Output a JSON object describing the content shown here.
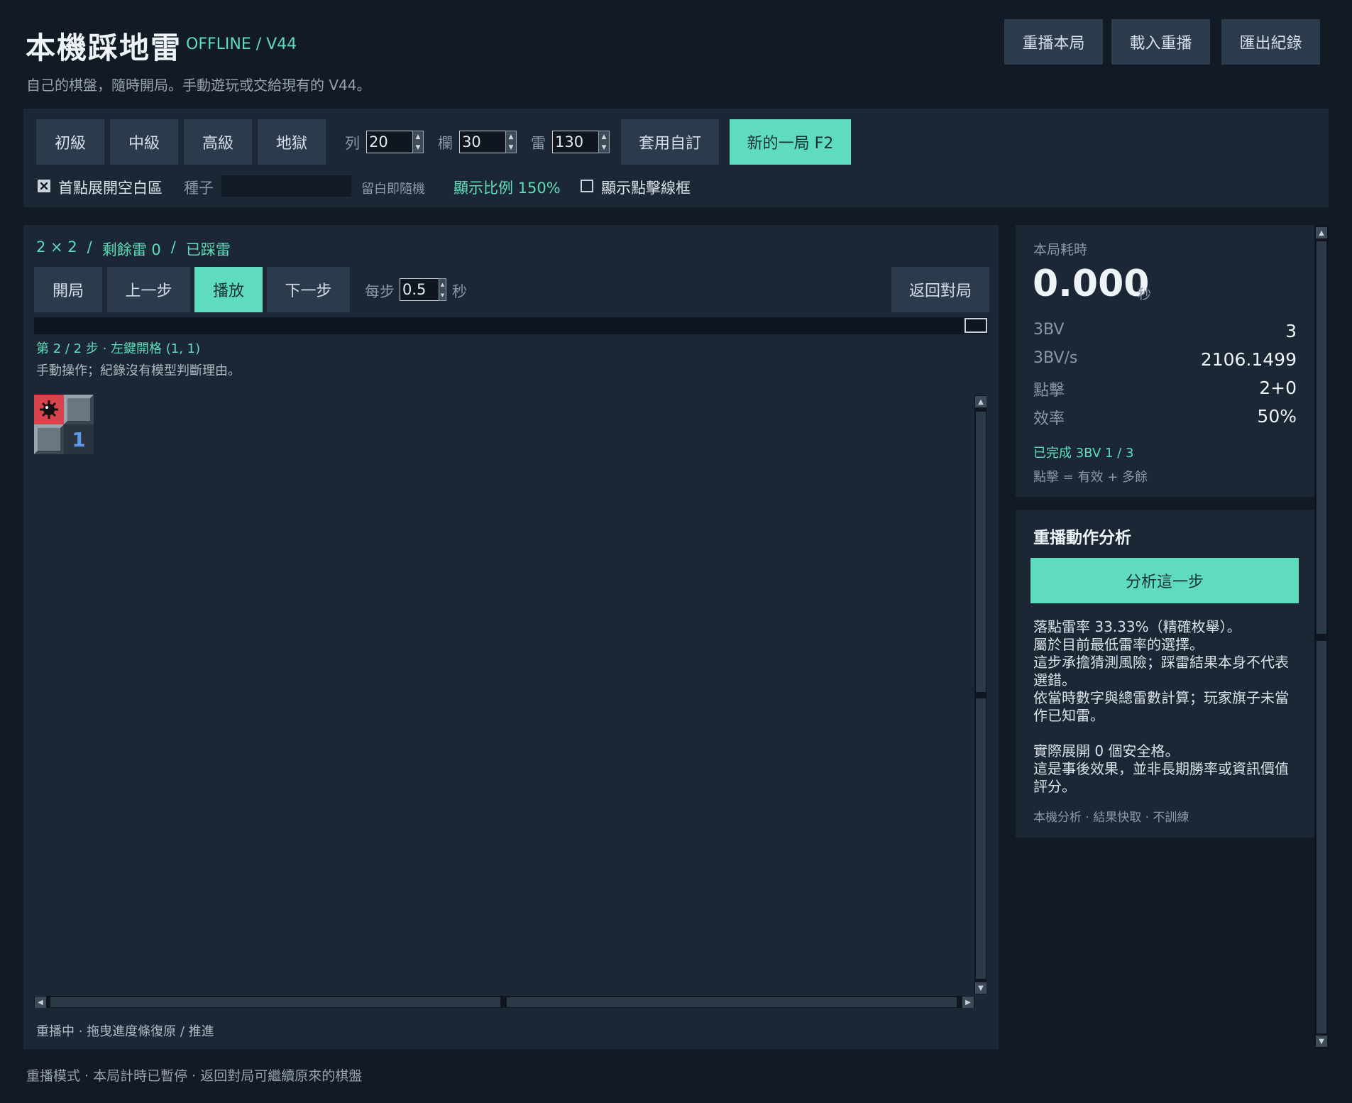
{
  "header": {
    "title": "本機踩地雷",
    "version": "OFFLINE / V44",
    "subtitle": "自己的棋盤，隨時開局。手動遊玩或交給現有的 V44。",
    "buttons": [
      "重播本局",
      "載入重播",
      "匯出紀錄"
    ]
  },
  "settings": {
    "levels": [
      "初級",
      "中級",
      "高級",
      "地獄"
    ],
    "rows_label": "列",
    "rows_value": "20",
    "cols_label": "欄",
    "cols_value": "30",
    "mines_label": "雷",
    "mines_value": "130",
    "apply_label": "套用自訂",
    "new_game_label": "新的一局  F2",
    "first_click_label": "首點展開空白區",
    "first_click_checked": true,
    "seed_label": "種子",
    "seed_value": "",
    "seed_hint": "留白即隨機",
    "scale_label": "顯示比例 150%",
    "show_frame_label": "顯示點擊線框",
    "show_frame_checked": false
  },
  "replay": {
    "status": {
      "size": "2 × 2",
      "sep1": "/",
      "remaining": "剩餘雷 0",
      "sep2": "/",
      "state": "已踩雷"
    },
    "controls": {
      "start": "開局",
      "prev": "上一步",
      "play": "播放",
      "next": "下一步",
      "per_step_label": "每步",
      "per_step_value": "0.5",
      "unit": "秒",
      "back": "返回對局"
    },
    "progress": 1.0,
    "step_text": "第 2 / 2 步 · 左鍵開格 (1, 1)",
    "step_note": "手動操作；紀錄沒有模型判斷理由。",
    "board": [
      [
        "mine",
        "raised"
      ],
      [
        "raised",
        "1"
      ]
    ],
    "footer": "重播中 · 拖曳進度條復原 / 推進"
  },
  "stats": {
    "time_label": "本局耗時",
    "time_value": "0.000",
    "time_unit": "秒",
    "rows": [
      {
        "k": "3BV",
        "v": "3"
      },
      {
        "k": "3BV/s",
        "v": "2106.1499"
      },
      {
        "k": "點擊",
        "v": "2+0"
      },
      {
        "k": "效率",
        "v": "50%"
      }
    ],
    "completed": "已完成 3BV  1 / 3",
    "click_note": "點擊 = 有效 + 多餘"
  },
  "analysis": {
    "title": "重播動作分析",
    "button": "分析這一步",
    "lines": [
      "落點雷率 33.33%（精確枚舉）。",
      "屬於目前最低雷率的選擇。",
      "這步承擔猜測風險；踩雷結果本身不代表",
      "選錯。",
      "依當時數字與總雷數計算；玩家旗子未當",
      "作已知雷。",
      "",
      "實際展開 0 個安全格。",
      "這是事後效果，並非長期勝率或資訊價值",
      "評分。"
    ],
    "footer": "本機分析 · 結果快取 · 不訓練"
  },
  "footer": "重播模式 · 本局計時已暫停 · 返回對局可繼續原來的棋盤"
}
